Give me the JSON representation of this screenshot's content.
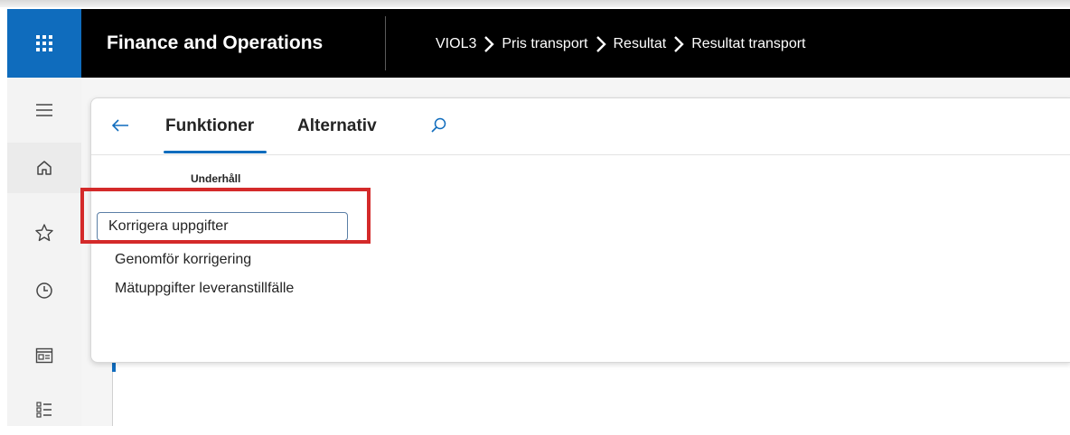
{
  "header": {
    "app_title": "Finance and Operations",
    "breadcrumb": [
      "VIOL3",
      "Pris transport",
      "Resultat",
      "Resultat transport"
    ]
  },
  "leftnav": {
    "items": [
      {
        "icon": "hamburger-icon"
      },
      {
        "icon": "home-icon"
      },
      {
        "icon": "star-icon"
      },
      {
        "icon": "clock-icon"
      },
      {
        "icon": "workspace-icon"
      },
      {
        "icon": "list-icon"
      }
    ]
  },
  "action_pane": {
    "tabs": [
      {
        "label": "Funktioner",
        "active": true
      },
      {
        "label": "Alternativ",
        "active": false
      }
    ],
    "group_header": "Underhåll",
    "items": [
      {
        "label": "Korrigera uppgifter",
        "selected": true
      },
      {
        "label": "Genomför korrigering",
        "selected": false
      },
      {
        "label": "Mätuppgifter leveranstillfälle",
        "selected": false
      }
    ]
  },
  "colors": {
    "accent": "#0f6cbd",
    "header_bg": "#000000",
    "annotation": "#d42a2a"
  }
}
